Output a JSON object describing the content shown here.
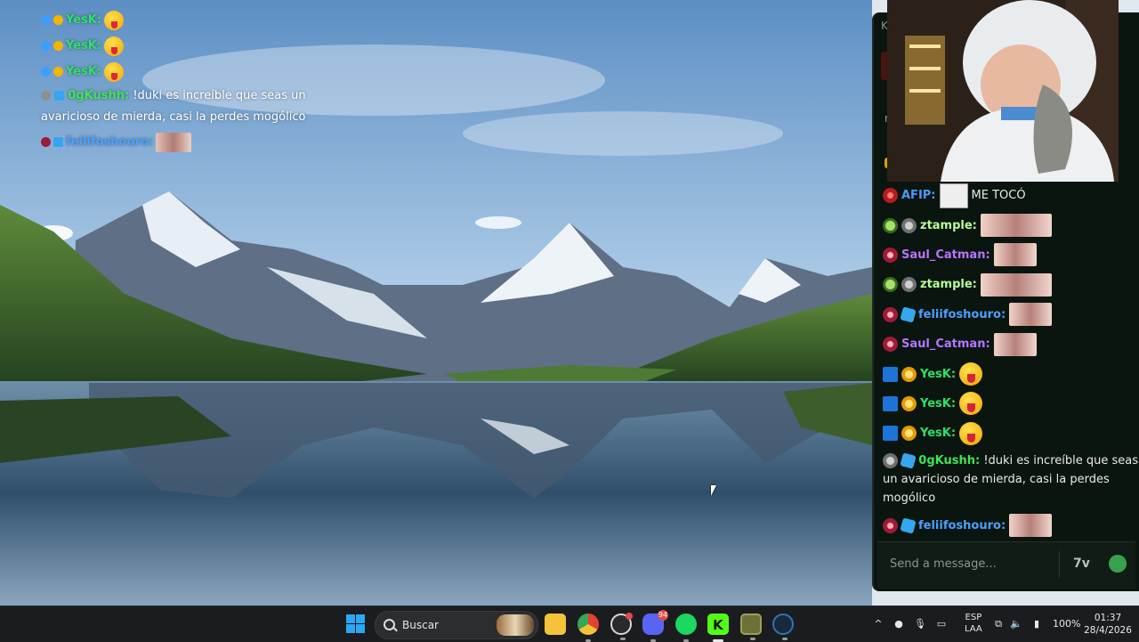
{
  "overlay_chat": {
    "lines": [
      {
        "type": "emote",
        "name": "YesK:"
      },
      {
        "type": "emote",
        "name": "YesK:"
      },
      {
        "type": "emote",
        "name": "YesK:"
      },
      {
        "type": "text",
        "name": "0gKushh:",
        "text": "!duki es increíble que seas un avaricioso de mierda, casi la perdes mogólico"
      },
      {
        "type": "image",
        "name": "feliifoshouro:"
      }
    ]
  },
  "chat": {
    "messages": [
      {
        "badges": [
          "red"
        ],
        "name": "AFIP:",
        "name_color": "#4a98ff",
        "emote": "meme",
        "text": "ME TOCÓ"
      },
      {
        "badges": [
          "ghost",
          "gray"
        ],
        "name": "ztample:",
        "name_color": "#b7ff9a",
        "emote": "wide"
      },
      {
        "badges": [
          "mouth"
        ],
        "name": "Saul_Catman:",
        "name_color": "#b675ff",
        "emote": "img"
      },
      {
        "badges": [
          "ghost",
          "gray"
        ],
        "name": "ztample:",
        "name_color": "#b7ff9a",
        "emote": "wide"
      },
      {
        "badges": [
          "mouth",
          "cube"
        ],
        "name": "feliifoshouro:",
        "name_color": "#4aa0ff",
        "emote": "img"
      },
      {
        "badges": [
          "mouth"
        ],
        "name": "Saul_Catman:",
        "name_color": "#b675ff",
        "emote": "img"
      },
      {
        "badges": [
          "hammer",
          "gold"
        ],
        "name": "YesK:",
        "name_color": "#2ee06a",
        "emote": "yes"
      },
      {
        "badges": [
          "hammer",
          "gold"
        ],
        "name": "YesK:",
        "name_color": "#2ee06a",
        "emote": "yes"
      },
      {
        "badges": [
          "hammer",
          "gold"
        ],
        "name": "YesK:",
        "name_color": "#2ee06a",
        "emote": "yes"
      },
      {
        "badges": [
          "gray",
          "cube"
        ],
        "name": "0gKushh:",
        "name_color": "#3ee35a",
        "text": "!duki es increíble que seas un avaricioso de mierda, casi la perdes mogólico"
      },
      {
        "badges": [
          "mouth",
          "cube"
        ],
        "name": "feliifoshouro:",
        "name_color": "#4aa0ff",
        "emote": "img"
      }
    ],
    "composer_placeholder": "Send a message..."
  },
  "taskbar": {
    "search_label": "Buscar",
    "apps": [
      {
        "icon": "file-explorer-icon",
        "color": "#f5c23a"
      },
      {
        "icon": "chrome-icon",
        "color": "#e34133"
      },
      {
        "icon": "obs-icon",
        "color": "#d8d8d8",
        "badge": ""
      },
      {
        "icon": "discord-icon",
        "color": "#5865f2",
        "badge": "94"
      },
      {
        "icon": "spotify-icon",
        "color": "#1ed760"
      },
      {
        "icon": "kick-icon",
        "color": "#53fc18"
      },
      {
        "icon": "game-icon",
        "color": "#a0a050"
      },
      {
        "icon": "steam-icon",
        "color": "#2a75bb"
      }
    ],
    "lang_top": "ESP",
    "lang_bottom": "LAA",
    "battery": "100%",
    "time": "01:37",
    "date": "28/4/2026"
  }
}
